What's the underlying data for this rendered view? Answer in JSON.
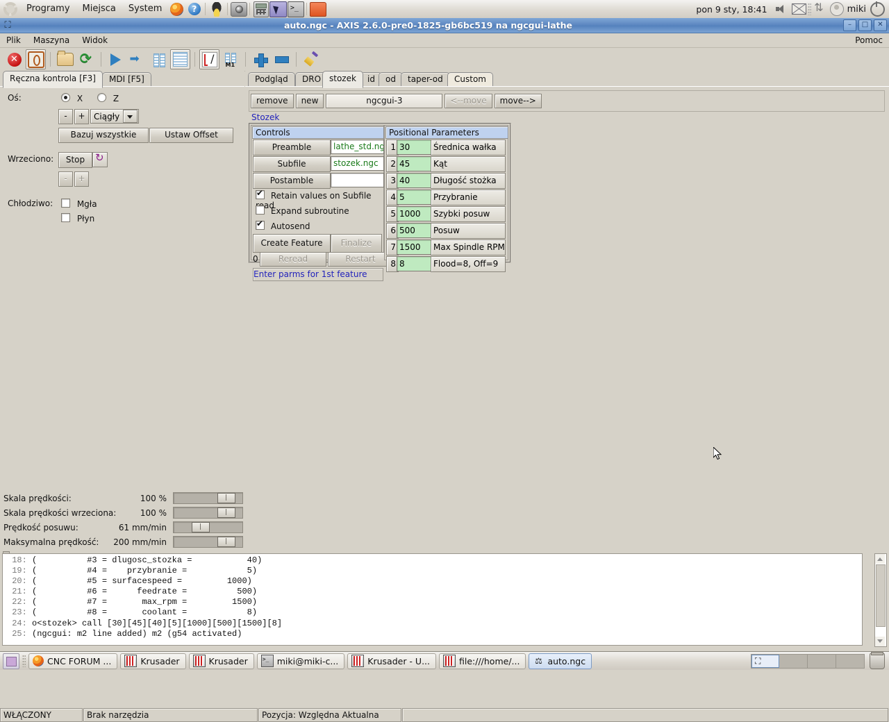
{
  "gnome_panel": {
    "menus": [
      "Programy",
      "Miejsca",
      "System"
    ],
    "launchers": [
      "firefox-icon",
      "help-icon",
      "tux-icon",
      "camera-icon",
      "calculator-icon",
      "window-switcher-icon",
      "terminal-icon",
      "folder-icon"
    ],
    "clock": "pon  9 sty, 18:41",
    "user": "miki",
    "tray_icons": [
      "volume-icon",
      "mail-icon",
      "update-icon",
      "user-icon",
      "power-icon"
    ]
  },
  "window": {
    "title": "auto.ngc - AXIS 2.6.0-pre0-1825-gb6bc519 na ngcgui-lathe",
    "icon": "axis-icon",
    "buttons": {
      "minimize": "–",
      "maximize": "□",
      "close": "✕"
    }
  },
  "menubar": {
    "items": [
      "Plik",
      "Maszyna",
      "Widok"
    ],
    "help": "Pomoc"
  },
  "toolbar": {
    "buttons": [
      {
        "name": "estop-icon",
        "tip": "ESTOP"
      },
      {
        "name": "machine-power-icon",
        "tip": "Power"
      },
      {
        "name": "open-file-icon",
        "tip": "Open"
      },
      {
        "name": "reload-file-icon",
        "tip": "Reload"
      },
      {
        "name": "run-program-icon",
        "tip": "Run"
      },
      {
        "name": "step-program-icon",
        "tip": "Step"
      },
      {
        "name": "pause-program-icon",
        "tip": "Pause"
      },
      {
        "name": "stop-program-icon",
        "tip": "Stop"
      },
      {
        "name": "block-delete-icon",
        "tip": "Block delete"
      },
      {
        "name": "optional-stop-icon",
        "tip": "Optional stop M1"
      },
      {
        "name": "zoom-in-icon",
        "tip": "Zoom in"
      },
      {
        "name": "zoom-out-icon",
        "tip": "Zoom out"
      },
      {
        "name": "clear-plot-icon",
        "tip": "Clear plot"
      }
    ]
  },
  "left_panel": {
    "tabs": [
      {
        "label": "Ręczna kontrola [F3]",
        "selected": true
      },
      {
        "label": "MDI [F5]",
        "selected": false
      }
    ],
    "axis_label": "Oś:",
    "axes": [
      {
        "label": "X",
        "selected": true
      },
      {
        "label": "Z",
        "selected": false
      }
    ],
    "jog_minus": "-",
    "jog_plus": "+",
    "jog_mode": "Ciągły",
    "home_all": "Bazuj wszystkie",
    "set_offset": "Ustaw Offset",
    "spindle_label": "Wrzeciono:",
    "spindle_stop": "Stop",
    "spindle_minus": "-",
    "spindle_plus": "+",
    "coolant_label": "Chłodziwo:",
    "coolant": [
      {
        "label": "Mgła",
        "checked": false
      },
      {
        "label": "Płyn",
        "checked": false
      }
    ],
    "sliders": [
      {
        "label": "Skala prędkości:",
        "value": "100 %",
        "pos": 93
      },
      {
        "label": "Skala prędkości wrzeciona:",
        "value": "100 %",
        "pos": 93
      },
      {
        "label": "Prędkość posuwu:",
        "value": "61 mm/min",
        "pos": 31
      },
      {
        "label": "Maksymalna prędkość:",
        "value": "200 mm/min",
        "pos": 93
      }
    ]
  },
  "right_panel": {
    "tabs": [
      {
        "label": "Podgląd",
        "selected": false
      },
      {
        "label": "DRO",
        "selected": false
      },
      {
        "label": "stozek",
        "selected": true
      },
      {
        "label": "id",
        "selected": false
      },
      {
        "label": "od",
        "selected": false
      },
      {
        "label": "taper-od",
        "selected": false
      },
      {
        "label": "Custom",
        "selected": false
      }
    ],
    "ngcbar": {
      "remove": "remove",
      "new": "new",
      "page_name": "ngcgui-3",
      "move_left": "<--move",
      "move_right": "move-->"
    },
    "feature_title": "Stozek",
    "controls": {
      "header": "Controls",
      "preamble_label": "Preamble",
      "preamble_value": "lathe_std.ngc",
      "subfile_label": "Subfile",
      "subfile_value": "stozek.ngc",
      "postamble_label": "Postamble",
      "postamble_value": "",
      "checkboxes": [
        {
          "label": "Retain values on Subfile read",
          "checked": true
        },
        {
          "label": "Expand subroutine",
          "checked": false
        },
        {
          "label": "Autosend",
          "checked": true
        }
      ],
      "create_feature": "Create Feature",
      "finalize": "Finalize",
      "count": "0",
      "reread": "Reread",
      "restart": "Restart",
      "status": "Enter parms for 1st feature"
    },
    "positional": {
      "header": "Positional Parameters",
      "rows": [
        {
          "num": "1",
          "value": "30",
          "desc": "Średnica wałka"
        },
        {
          "num": "2",
          "value": "45",
          "desc": "Kąt"
        },
        {
          "num": "3",
          "value": "40",
          "desc": "Długość stożka"
        },
        {
          "num": "4",
          "value": "5",
          "desc": "Przybranie"
        },
        {
          "num": "5",
          "value": "1000",
          "desc": "Szybki posuw"
        },
        {
          "num": "6",
          "value": "500",
          "desc": "Posuw"
        },
        {
          "num": "7",
          "value": "1500",
          "desc": "Max Spindle RPM"
        },
        {
          "num": "8",
          "value": "8",
          "desc": "Flood=8, Off=9"
        }
      ]
    }
  },
  "gcode": {
    "lines": [
      {
        "n": "18:",
        "text": "(          #3 = dlugosc_stozka =           40)"
      },
      {
        "n": "19:",
        "text": "(          #4 =    przybranie =            5)"
      },
      {
        "n": "20:",
        "text": "(          #5 = surfacespeed =         1000)"
      },
      {
        "n": "21:",
        "text": "(          #6 =      feedrate =          500)"
      },
      {
        "n": "22:",
        "text": "(          #7 =       max_rpm =         1500)"
      },
      {
        "n": "23:",
        "text": "(          #8 =       coolant =            8)"
      },
      {
        "n": "24:",
        "text": "o<stozek> call [30][45][40][5][1000][500][1500][8]"
      },
      {
        "n": "25:",
        "text": "(ngcgui: m2 line added) m2 (g54 activated)"
      }
    ]
  },
  "statusbar": {
    "machine_state": "WŁĄCZONY",
    "tool": "Brak narzędzia",
    "position": "Pozycja: Względna Aktualna"
  },
  "taskbar": {
    "show_desktop": "show-desktop-icon",
    "tasks": [
      {
        "label": "CNC FORUM ...",
        "icon": "firefox-icon",
        "active": false
      },
      {
        "label": "Krusader",
        "icon": "krusader-icon",
        "active": false
      },
      {
        "label": "Krusader",
        "icon": "krusader-icon",
        "active": false
      },
      {
        "label": "miki@miki-c...",
        "icon": "terminal-icon",
        "active": false
      },
      {
        "label": "Krusader - U...",
        "icon": "krusader-icon",
        "active": false
      },
      {
        "label": "file:///home/...",
        "icon": "krusader-icon",
        "active": false
      },
      {
        "label": "auto.ngc",
        "icon": "axis-icon",
        "active": true
      }
    ],
    "workspaces": 4,
    "active_workspace": 1,
    "trash": "trash-icon"
  },
  "colors": {
    "titlebar": "#5c86c0",
    "bg": "#d6d2c8",
    "section_header": "#bfd2ef",
    "param_value": "#bfeac0",
    "status_text": "#2222bb",
    "entry_text": "#1a7a1a"
  }
}
